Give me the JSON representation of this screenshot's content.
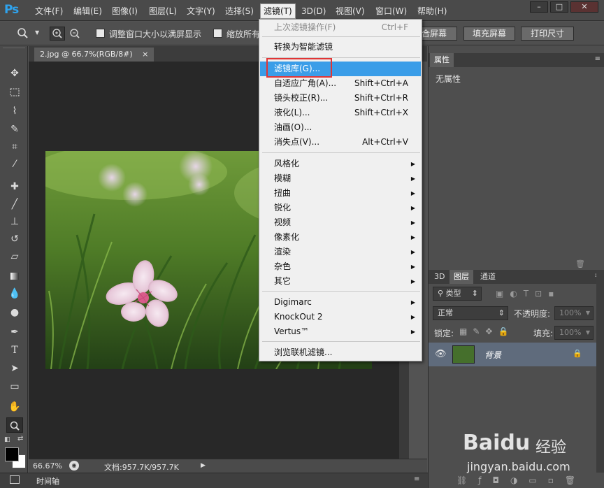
{
  "app": {
    "logo": "Ps"
  },
  "menubar": {
    "items": [
      "文件(F)",
      "编辑(E)",
      "图像(I)",
      "图层(L)",
      "文字(Y)",
      "选择(S)",
      "滤镜(T)",
      "3D(D)",
      "视图(V)",
      "窗口(W)",
      "帮助(H)"
    ],
    "active": "滤镜(T)",
    "window_controls": [
      "–",
      "□",
      "✕"
    ]
  },
  "options": {
    "resize_window_label": "调整窗口大小以满屏显示",
    "zoom_all_label": "缩放所有",
    "fit_screen_btn": "合屏幕",
    "fill_screen_btn": "填充屏幕",
    "print_size_btn": "打印尺寸"
  },
  "document": {
    "tab_title": "2.jpg @ 66.7%(RGB/8#)",
    "tab_close": "×",
    "zoom": "66.67%",
    "doc_info": "文档:957.7K/957.7K"
  },
  "timeline": {
    "label": "时间轴"
  },
  "filter_menu": {
    "last_filter": {
      "label": "上次滤镜操作(F)",
      "shortcut": "Ctrl+F"
    },
    "smart_filter": "转换为智能滤镜",
    "group1": [
      {
        "label": "滤镜库(G)...",
        "shortcut": ""
      },
      {
        "label": "自适应广角(A)...",
        "shortcut": "Shift+Ctrl+A"
      },
      {
        "label": "镜头校正(R)...",
        "shortcut": "Shift+Ctrl+R"
      },
      {
        "label": "液化(L)...",
        "shortcut": "Shift+Ctrl+X"
      },
      {
        "label": "油画(O)...",
        "shortcut": ""
      },
      {
        "label": "消失点(V)...",
        "shortcut": "Alt+Ctrl+V"
      }
    ],
    "submenus": [
      "风格化",
      "模糊",
      "扭曲",
      "锐化",
      "视频",
      "像素化",
      "渲染",
      "杂色",
      "其它"
    ],
    "plugins": [
      "Digimarc",
      "KnockOut 2",
      "Vertus™"
    ],
    "browse_online": "浏览联机滤镜..."
  },
  "properties_panel": {
    "tab": "属性",
    "empty_text": "无属性"
  },
  "layers_panel": {
    "tabs": [
      "3D",
      "图层",
      "通道"
    ],
    "active_tab": "图层",
    "kind_filter": "类型",
    "blend_mode": "正常",
    "opacity_label": "不透明度:",
    "opacity_value": "100%",
    "lock_label": "锁定:",
    "fill_label": "填充:",
    "fill_value": "100%",
    "layers": [
      {
        "name": "背景",
        "visible": true,
        "locked": true
      }
    ]
  },
  "watermark": {
    "brand": "Baidu",
    "suffix": "经验",
    "url": "jingyan.baidu.com"
  }
}
